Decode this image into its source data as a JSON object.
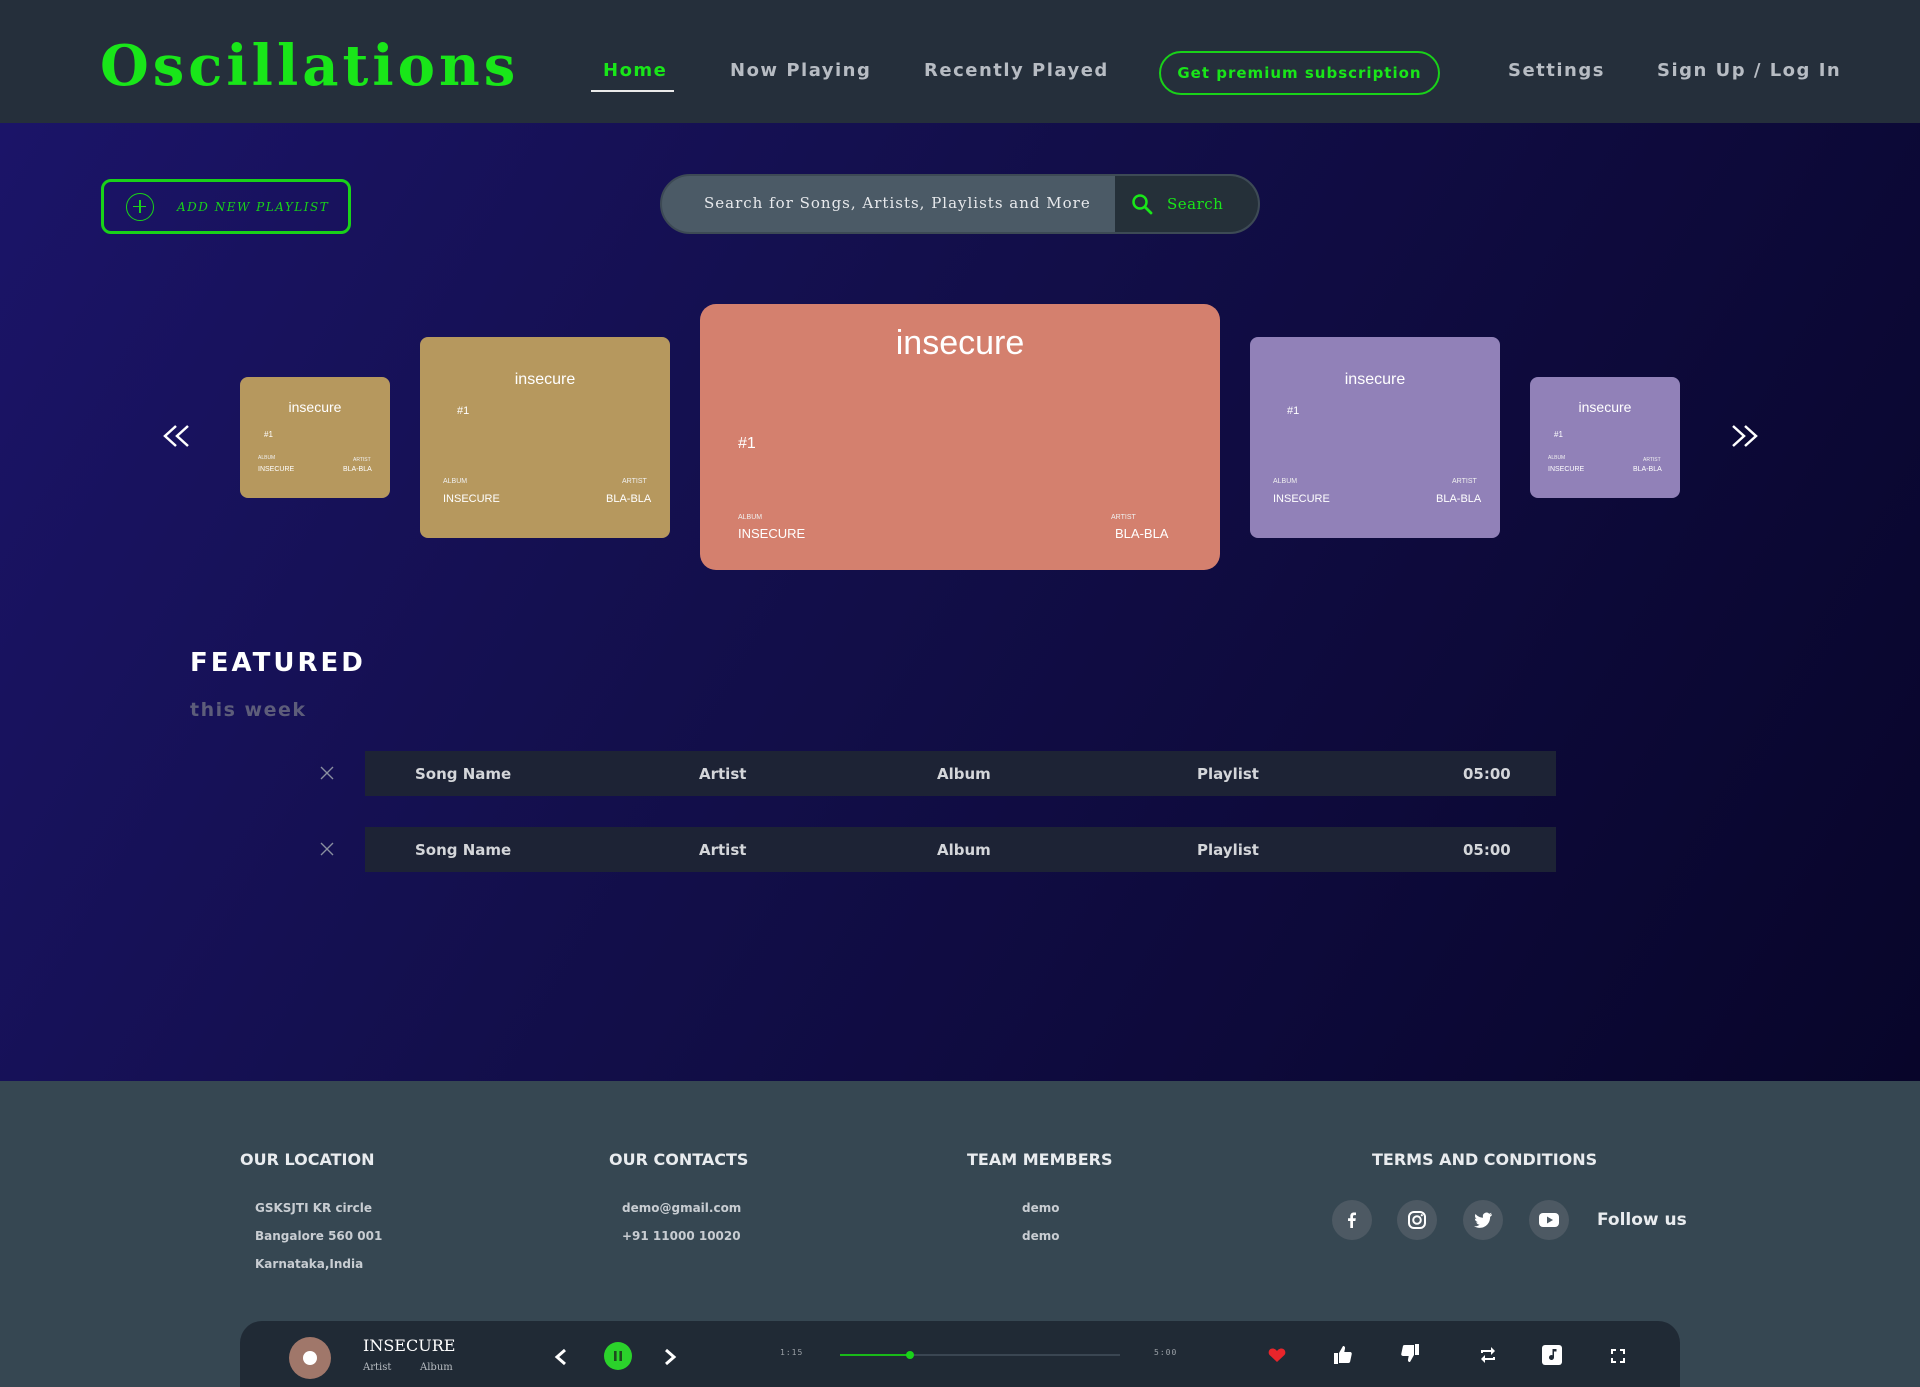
{
  "header": {
    "logo": "Oscillations",
    "nav": {
      "home": "Home",
      "now_playing": "Now Playing",
      "recently_played": "Recently Played",
      "premium": "Get premium subscription",
      "settings": "Settings",
      "auth": "Sign Up / Log In"
    },
    "accent_color": "#19e619",
    "active_item": "Home"
  },
  "toolbar": {
    "add_playlist_label": "ADD NEW PLAYLIST",
    "search_placeholder": "Search for Songs, Artists, Playlists and More",
    "search_button": "Search"
  },
  "carousel": {
    "cards": [
      {
        "title": "insecure",
        "rank": "#1",
        "album_label": "ALBUM",
        "album": "INSECURE",
        "artist_label": "ARTIST",
        "artist": "BLA-BLA",
        "color": "#b6985e"
      },
      {
        "title": "insecure",
        "rank": "#1",
        "album_label": "ALBUM",
        "album": "INSECURE",
        "artist_label": "ARTIST",
        "artist": "BLA-BLA",
        "color": "#b6985e"
      },
      {
        "title": "insecure",
        "rank": "#1",
        "album_label": "ALBUM",
        "album": "INSECURE",
        "artist_label": "ARTIST",
        "artist": "BLA-BLA",
        "color": "#d4806e"
      },
      {
        "title": "insecure",
        "rank": "#1",
        "album_label": "ALBUM",
        "album": "INSECURE",
        "artist_label": "ARTIST",
        "artist": "BLA-BLA",
        "color": "#9181b8"
      },
      {
        "title": "insecure",
        "rank": "#1",
        "album_label": "ALBUM",
        "album": "INSECURE",
        "artist_label": "ARTIST",
        "artist": "BLA-BLA",
        "color": "#9181b8"
      }
    ],
    "prev_icon": "double-chevron-left-icon",
    "next_icon": "double-chevron-right-icon"
  },
  "featured": {
    "title": "FEATURED",
    "subtitle": "this week",
    "rows": [
      {
        "song": "Song Name",
        "artist": "Artist",
        "album": "Album",
        "playlist": "Playlist",
        "duration": "05:00"
      },
      {
        "song": "Song Name",
        "artist": "Artist",
        "album": "Album",
        "playlist": "Playlist",
        "duration": "05:00"
      }
    ]
  },
  "footer": {
    "location": {
      "heading": "OUR LOCATION",
      "lines": [
        "GSKSJTI KR circle",
        "Bangalore 560 001",
        "Karnataka,India"
      ]
    },
    "contacts": {
      "heading": "OUR CONTACTS",
      "lines": [
        "demo@gmail.com",
        "+91 11000 10020"
      ]
    },
    "team": {
      "heading": "TEAM MEMBERS",
      "lines": [
        "demo",
        "demo"
      ]
    },
    "terms": {
      "heading": "TERMS AND CONDITIONS"
    },
    "social": [
      "facebook-icon",
      "instagram-icon",
      "twitter-icon",
      "youtube-icon"
    ],
    "follow_label": "Follow us"
  },
  "player": {
    "title": "INSECURE",
    "artist": "Artist",
    "album": "Album",
    "elapsed": "1:15",
    "total": "5:00",
    "progress": 0.25,
    "liked": true,
    "like_color": "#e8252b"
  }
}
